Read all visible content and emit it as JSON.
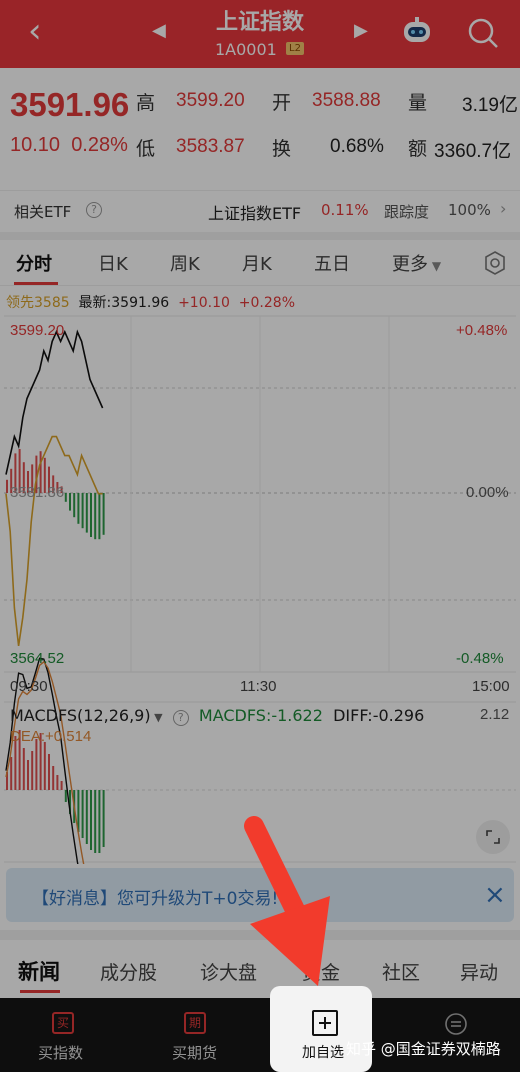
{
  "header": {
    "title": "上证指数",
    "code": "1A0001",
    "level": "L2"
  },
  "quote": {
    "price": "3591.96",
    "change": "10.10",
    "change_pct": "0.28%",
    "labels": {
      "high": "高",
      "open": "开",
      "volume": "量",
      "low": "低",
      "turnover": "换",
      "amount": "额"
    },
    "high": "3599.20",
    "open": "3588.88",
    "volume": "3.19亿",
    "low": "3583.87",
    "turnover": "0.68%",
    "amount": "3360.7亿"
  },
  "etf": {
    "label": "相关ETF",
    "name": "上证指数ETF",
    "pct": "0.11%",
    "track_label": "跟踪度",
    "track_value": "100%"
  },
  "tabs": [
    "分时",
    "日K",
    "周K",
    "月K",
    "五日",
    "更多"
  ],
  "info": {
    "lead": "领先3585",
    "latest": "最新:3591.96",
    "chg": "+10.10",
    "pct": "+0.28%"
  },
  "price_axis": {
    "top": "3599.20",
    "mid": "3581.86",
    "bottom": "3564.52",
    "top_pct": "+0.48%",
    "mid_pct": "0.00%",
    "bottom_pct": "-0.48%"
  },
  "time_axis": [
    "09:30",
    "11:30",
    "15:00"
  ],
  "macd": {
    "name": "MACDFS(12,26,9)",
    "macdfs": "MACDFS:-1.622",
    "diff": "DIFF:-0.296",
    "dea": "DEA:+0.514",
    "scale": "2.12"
  },
  "banner": {
    "text": "【好消息】您可升级为T+0交易!"
  },
  "news_tabs": [
    "新闻",
    "成分股",
    "诊大盘",
    "资金",
    "社区",
    "异动"
  ],
  "bottom": {
    "buy_index": "买指数",
    "buy_futures": "买期货",
    "add_watch": "加自选",
    "buy_icon": "买",
    "futures_icon": "期"
  },
  "watermark": "知乎 @国金证券双楠路",
  "chart_data": {
    "type": "line",
    "x": [
      "09:30",
      "09:33",
      "09:36",
      "09:39",
      "09:42",
      "09:45",
      "09:48",
      "09:51",
      "09:54",
      "09:57",
      "10:00",
      "10:03",
      "10:06",
      "10:09",
      "10:12",
      "10:15",
      "10:18",
      "10:21",
      "10:24",
      "10:27",
      "10:30",
      "10:33",
      "10:36",
      "10:39"
    ],
    "series": [
      {
        "values": [
          3584,
          3586,
          3588,
          3587,
          3590,
          3592,
          3593,
          3594,
          3595,
          3597,
          3596,
          3598,
          3599,
          3598,
          3599,
          3598,
          3597,
          3599,
          3598,
          3596,
          3594,
          3593,
          3592,
          3591
        ]
      },
      {
        "values": [
          3582,
          3578,
          3570,
          3566,
          3569,
          3573,
          3579,
          3583,
          3585,
          3586,
          3587,
          3588,
          3588,
          3587,
          3586,
          3586,
          3585,
          3584,
          3586,
          3585,
          3584,
          3583,
          3582,
          3582
        ]
      }
    ],
    "ylim": [
      3564.52,
      3599.2
    ],
    "macd_bars": [
      0.6,
      1.1,
      1.8,
      2.0,
      1.4,
      1.0,
      1.3,
      1.7,
      1.9,
      1.6,
      1.2,
      0.8,
      0.5,
      0.3,
      -0.4,
      -0.8,
      -1.1,
      -1.4,
      -1.6,
      -1.8,
      -2.0,
      -2.1,
      -2.1,
      -1.9
    ]
  }
}
